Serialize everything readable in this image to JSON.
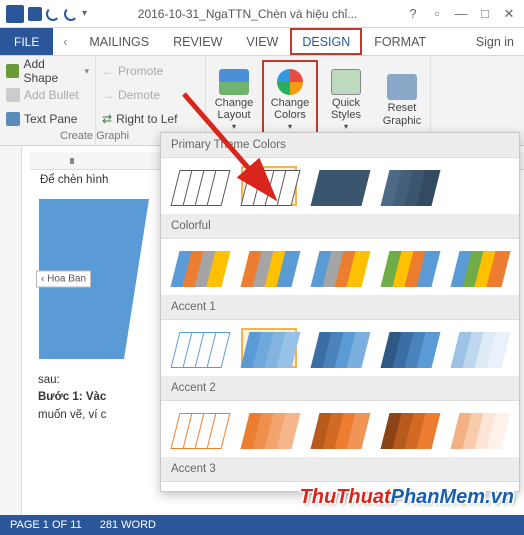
{
  "titlebar": {
    "title": "2016-10-31_NgaTTN_Chèn và hiệu chỉ..."
  },
  "tabs": {
    "file": "FILE",
    "items": [
      "MAILINGS",
      "REVIEW",
      "VIEW",
      "DESIGN",
      "FORMAT"
    ],
    "active_index": 3,
    "signin": "Sign in"
  },
  "ribbon": {
    "left_group": {
      "add_shape": "Add Shape",
      "add_bullet": "Add Bullet",
      "text_pane": "Text Pane"
    },
    "mid_group": {
      "promote": "Promote",
      "demote": "Demote",
      "rtl": "Right to Lef"
    },
    "create_graphic_label": "Create Graphi",
    "buttons": {
      "change_layout": "Change Layout",
      "change_colors": "Change Colors",
      "quick_styles": "Quick Styles",
      "reset_graphic": "Reset Graphic"
    }
  },
  "doc": {
    "heading": "Để chèn hình",
    "shape_label": "Hoa Ban",
    "after_shape_1": "sau:",
    "after_shape_2": "Bước 1: Vàc",
    "after_shape_3": "muốn vẽ, ví c"
  },
  "gallery": {
    "sections": [
      {
        "title": "Primary Theme Colors",
        "rows": [
          [
            {
              "type": "outline",
              "colors": [
                "#555",
                "#555",
                "#555",
                "#555"
              ],
              "selected": false
            },
            {
              "type": "outline",
              "colors": [
                "#555",
                "#555",
                "#555",
                "#555"
              ],
              "selected": true
            },
            {
              "type": "solid",
              "colors": [
                "#3b556e",
                "#3b556e",
                "#3b556e",
                "#3b556e"
              ],
              "selected": false
            },
            {
              "type": "solid",
              "colors": [
                "#4d6a86",
                "#435f79",
                "#3b556e",
                "#334a60"
              ],
              "selected": false
            }
          ]
        ]
      },
      {
        "title": "Colorful",
        "rows": [
          [
            {
              "type": "solid",
              "colors": [
                "#5b9bd5",
                "#ed7d31",
                "#a5a5a5",
                "#ffc000"
              ]
            },
            {
              "type": "solid",
              "colors": [
                "#ed7d31",
                "#a5a5a5",
                "#ffc000",
                "#5b9bd5"
              ]
            },
            {
              "type": "solid",
              "colors": [
                "#5b9bd5",
                "#a5a5a5",
                "#ed7d31",
                "#ffc000"
              ]
            },
            {
              "type": "solid",
              "colors": [
                "#70ad47",
                "#ffc000",
                "#ed7d31",
                "#5b9bd5"
              ]
            },
            {
              "type": "solid",
              "colors": [
                "#5b9bd5",
                "#70ad47",
                "#ffc000",
                "#ed7d31"
              ]
            }
          ]
        ]
      },
      {
        "title": "Accent 1",
        "rows": [
          [
            {
              "type": "outline",
              "colors": [
                "#5b9bd5",
                "#5b9bd5",
                "#5b9bd5",
                "#5b9bd5"
              ]
            },
            {
              "type": "solid",
              "colors": [
                "#5b9bd5",
                "#6fa8db",
                "#83b4e1",
                "#97c1e7"
              ],
              "selected": true
            },
            {
              "type": "solid",
              "colors": [
                "#3a6ea5",
                "#4a82bc",
                "#5b9bd5",
                "#7bb0de"
              ]
            },
            {
              "type": "solid",
              "colors": [
                "#2e5984",
                "#3a6ea5",
                "#4a82bc",
                "#5b9bd5"
              ]
            },
            {
              "type": "solid",
              "colors": [
                "#9cc3e5",
                "#bdd7ee",
                "#deebf7",
                "#eaf1fa"
              ]
            }
          ]
        ]
      },
      {
        "title": "Accent 2",
        "rows": [
          [
            {
              "type": "outline",
              "colors": [
                "#ed7d31",
                "#ed7d31",
                "#ed7d31",
                "#ed7d31"
              ]
            },
            {
              "type": "solid",
              "colors": [
                "#ed7d31",
                "#f0904f",
                "#f3a36d",
                "#f6b68b"
              ]
            },
            {
              "type": "solid",
              "colors": [
                "#b85a1c",
                "#d26a24",
                "#ed7d31",
                "#f19557"
              ]
            },
            {
              "type": "solid",
              "colors": [
                "#8c4416",
                "#b85a1c",
                "#d26a24",
                "#ed7d31"
              ]
            },
            {
              "type": "solid",
              "colors": [
                "#f4b183",
                "#f8cbad",
                "#fbe5d6",
                "#fdf2ea"
              ]
            }
          ]
        ]
      },
      {
        "title": "Accent 3",
        "rows": []
      }
    ]
  },
  "status": {
    "page": "PAGE 1 OF 11",
    "words": "281 WORD"
  },
  "watermark": {
    "part1": "ThuThuat",
    "part2": "PhanMem",
    "part3": ".vn"
  }
}
